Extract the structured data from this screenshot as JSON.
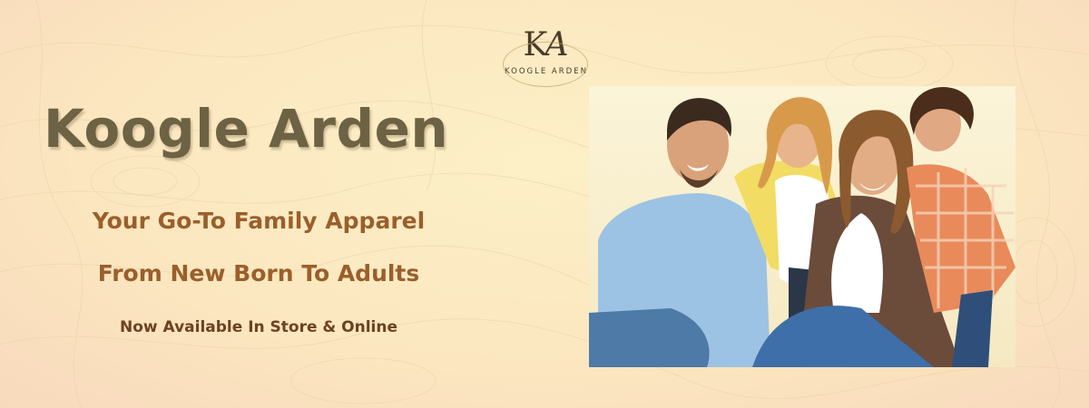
{
  "brand": {
    "logo_monogram_k": "K",
    "logo_monogram_a": "A",
    "logo_wordmark": "KOOGLE ARDEN",
    "title": "Koogle Arden"
  },
  "tagline": {
    "line1": "Your Go-To Family Apparel",
    "line2": "From New Born To Adults"
  },
  "availability": "Now Available In Store & Online",
  "colors": {
    "background": "#fdf0c6",
    "title": "#6d6244",
    "tagline": "#9a5f2b",
    "availability": "#6c4220"
  },
  "photo": {
    "subject_icon": "family-photo"
  }
}
